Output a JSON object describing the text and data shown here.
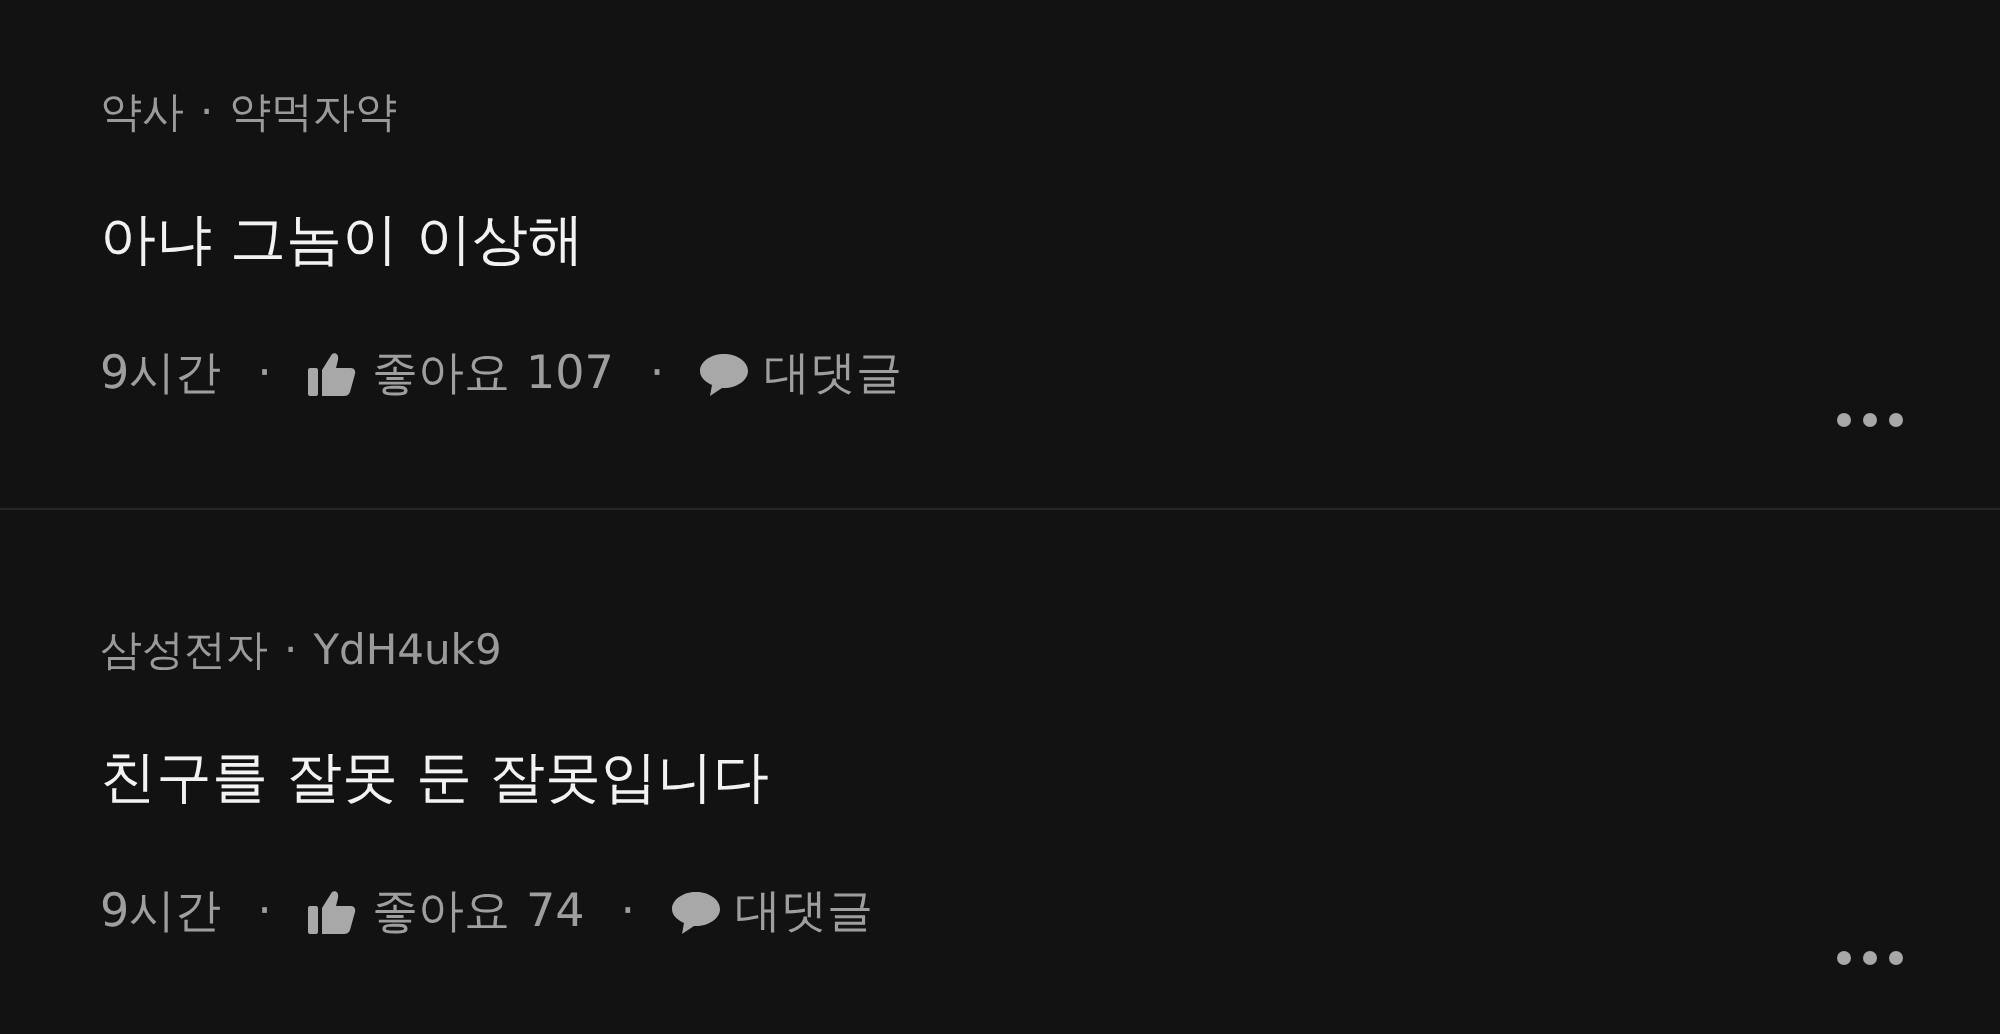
{
  "comments": [
    {
      "category": "약사",
      "meta_separator": "·",
      "author": "약먹자약",
      "text": "아냐 그놈이 이상해",
      "time": "9시간",
      "separator_1": "·",
      "like_label": "좋아요",
      "likes": "107",
      "separator_2": "·",
      "reply_label": "대댓글"
    },
    {
      "category": "삼성전자",
      "meta_separator": "·",
      "author": "YdH4uk9",
      "text": "친구를 잘못 둔 잘못입니다",
      "time": "9시간",
      "separator_1": "·",
      "like_label": "좋아요",
      "likes": "74",
      "separator_2": "·",
      "reply_label": "대댓글"
    }
  ]
}
